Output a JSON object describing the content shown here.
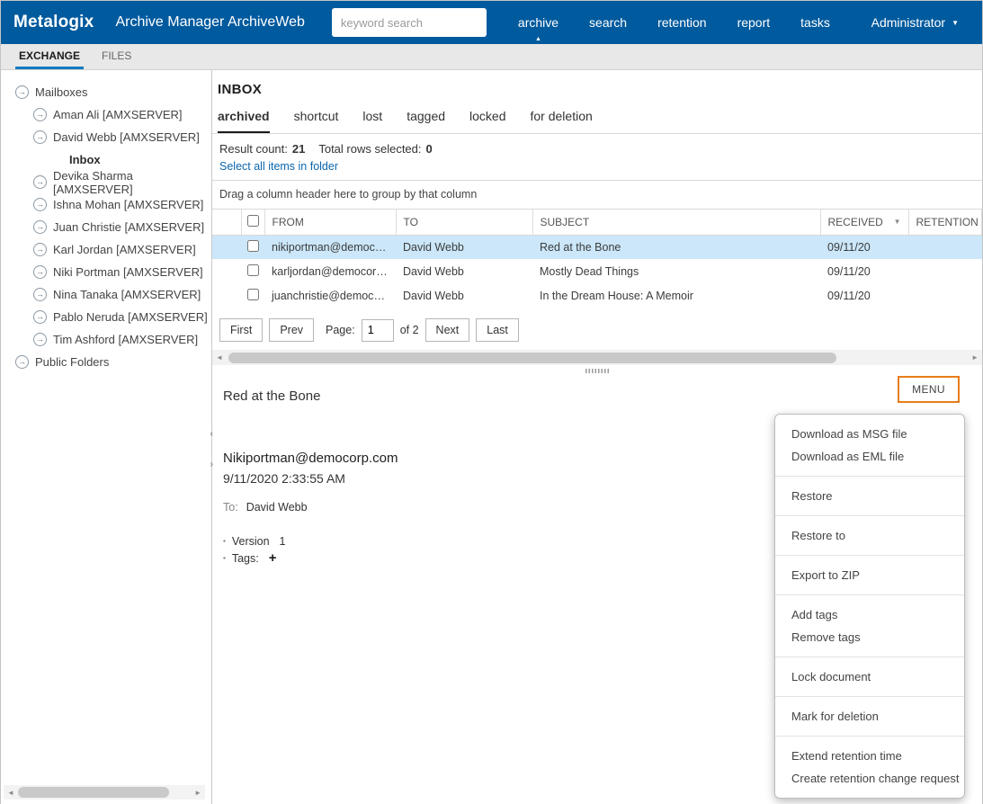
{
  "colors": {
    "topbar_bg": "#005A9E",
    "tab_accent": "#1579C2",
    "link": "#0A66B0",
    "selected_row_bg": "#CBE7F9",
    "menu_button_border": "#E87D1A"
  },
  "icons": {
    "tree_arrow": "→",
    "nav_active_caret": "▲",
    "user_caret": "▼",
    "filter_caret": "▼",
    "scroll_left": "◄",
    "scroll_right": "►",
    "collapse_left": "‹",
    "collapse_right": "›",
    "bullet": "▪"
  },
  "topbar": {
    "logo": "Metalogix",
    "title": "Archive Manager ArchiveWeb",
    "search_placeholder": "keyword search",
    "nav": [
      {
        "label": "archive"
      },
      {
        "label": "search"
      },
      {
        "label": "retention"
      },
      {
        "label": "report"
      },
      {
        "label": "tasks"
      }
    ],
    "user": "Administrator"
  },
  "module_tabs": [
    {
      "label": "EXCHANGE"
    },
    {
      "label": "FILES"
    }
  ],
  "sidebar": {
    "tree": [
      {
        "label": "Mailboxes"
      },
      {
        "label": "Aman Ali [AMXSERVER]"
      },
      {
        "label": "David Webb [AMXSERVER]"
      },
      {
        "label": "Inbox"
      },
      {
        "label": "Devika Sharma [AMXSERVER]"
      },
      {
        "label": "Ishna Mohan [AMXSERVER]"
      },
      {
        "label": "Juan Christie [AMXSERVER]"
      },
      {
        "label": "Karl Jordan [AMXSERVER]"
      },
      {
        "label": "Niki Portman [AMXSERVER]"
      },
      {
        "label": "Nina Tanaka [AMXSERVER]"
      },
      {
        "label": "Pablo Neruda [AMXSERVER]"
      },
      {
        "label": "Tim Ashford [AMXSERVER]"
      },
      {
        "label": "Public Folders"
      }
    ]
  },
  "main": {
    "folder_title": "INBOX",
    "view_tabs": [
      {
        "label": "archived"
      },
      {
        "label": "shortcut"
      },
      {
        "label": "lost"
      },
      {
        "label": "tagged"
      },
      {
        "label": "locked"
      },
      {
        "label": "for deletion"
      }
    ],
    "result_count_label": "Result count:",
    "result_count": "21",
    "selected_label": "Total rows selected:",
    "selected_count": "0",
    "select_all_link": "Select all items in folder",
    "group_hint": "Drag a column header here to group by that column",
    "table": {
      "columns": [
        "FROM",
        "TO",
        "SUBJECT",
        "RECEIVED",
        "RETENTION"
      ],
      "rows": [
        {
          "from": "nikiportman@democor...",
          "to": "David Webb",
          "subject": "Red at the Bone",
          "received": "09/11/20"
        },
        {
          "from": "karljordan@democorp.c...",
          "to": "David Webb",
          "subject": "Mostly Dead Things",
          "received": "09/11/20"
        },
        {
          "from": "juanchristie@democorp....",
          "to": "David Webb",
          "subject": "In the Dream House: A Memoir",
          "received": "09/11/20"
        }
      ]
    },
    "pagination": {
      "first": "First",
      "prev": "Prev",
      "page_label": "Page:",
      "page_value": "1",
      "of_label": "of 2",
      "next": "Next",
      "last": "Last"
    }
  },
  "preview": {
    "subject": "Red at the Bone",
    "menu_button": "MENU",
    "from": "Nikiportman@democorp.com",
    "date": "9/11/2020 2:33:55 AM",
    "to_label": "To:",
    "to_value": "David Webb",
    "version_label": "Version",
    "version_value": "1",
    "tags_label": "Tags:",
    "add_tag_button": "+"
  },
  "menu": {
    "groups": [
      {
        "items": [
          "Download as MSG file",
          "Download as EML file"
        ]
      },
      {
        "items": [
          "Restore"
        ]
      },
      {
        "items": [
          "Restore to"
        ]
      },
      {
        "items": [
          "Export to ZIP"
        ]
      },
      {
        "items": [
          "Add tags",
          "Remove tags"
        ]
      },
      {
        "items": [
          "Lock document"
        ]
      },
      {
        "items": [
          "Mark for deletion"
        ]
      },
      {
        "items": [
          "Extend retention time",
          "Create retention change request"
        ]
      }
    ]
  }
}
